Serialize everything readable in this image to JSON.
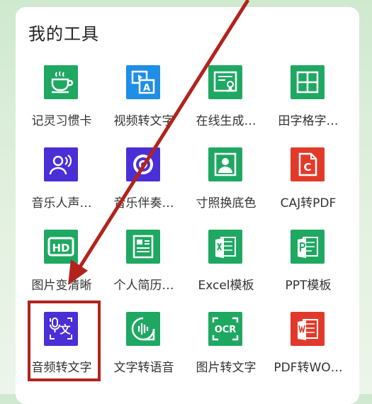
{
  "card": {
    "title": "我的工具"
  },
  "tools": [
    {
      "label": "记灵习惯卡",
      "icon": "coffee-cup-icon",
      "color": "green"
    },
    {
      "label": "视频转文字",
      "icon": "video-to-text-icon",
      "color": "blue"
    },
    {
      "label": "在线生成…",
      "icon": "certificate-icon",
      "color": "green"
    },
    {
      "label": "田字格字…",
      "icon": "grid-icon",
      "color": "green"
    },
    {
      "label": "音乐人声…",
      "icon": "voice-person-icon",
      "color": "purple"
    },
    {
      "label": "音乐伴奏…",
      "icon": "vinyl-record-icon",
      "color": "purple"
    },
    {
      "label": "寸照换底色",
      "icon": "id-photo-icon",
      "color": "green"
    },
    {
      "label": "CAJ转PDF",
      "icon": "caj-file-icon",
      "color": "red"
    },
    {
      "label": "图片变清晰",
      "icon": "hd-icon",
      "color": "green"
    },
    {
      "label": "个人简历…",
      "icon": "resume-document-icon",
      "color": "green"
    },
    {
      "label": "Excel模板",
      "icon": "excel-icon",
      "color": "green"
    },
    {
      "label": "PPT模板",
      "icon": "ppt-icon",
      "color": "green"
    },
    {
      "label": "音频转文字",
      "icon": "audio-to-text-icon",
      "color": "purple"
    },
    {
      "label": "文字转语音",
      "icon": "text-to-speech-icon",
      "color": "green"
    },
    {
      "label": "图片转文字",
      "icon": "ocr-icon",
      "color": "green"
    },
    {
      "label": "PDF转WO…",
      "icon": "word-icon",
      "color": "red"
    }
  ],
  "ocr_text": "OCR",
  "hd_text": "HD",
  "caj_letter": "C"
}
